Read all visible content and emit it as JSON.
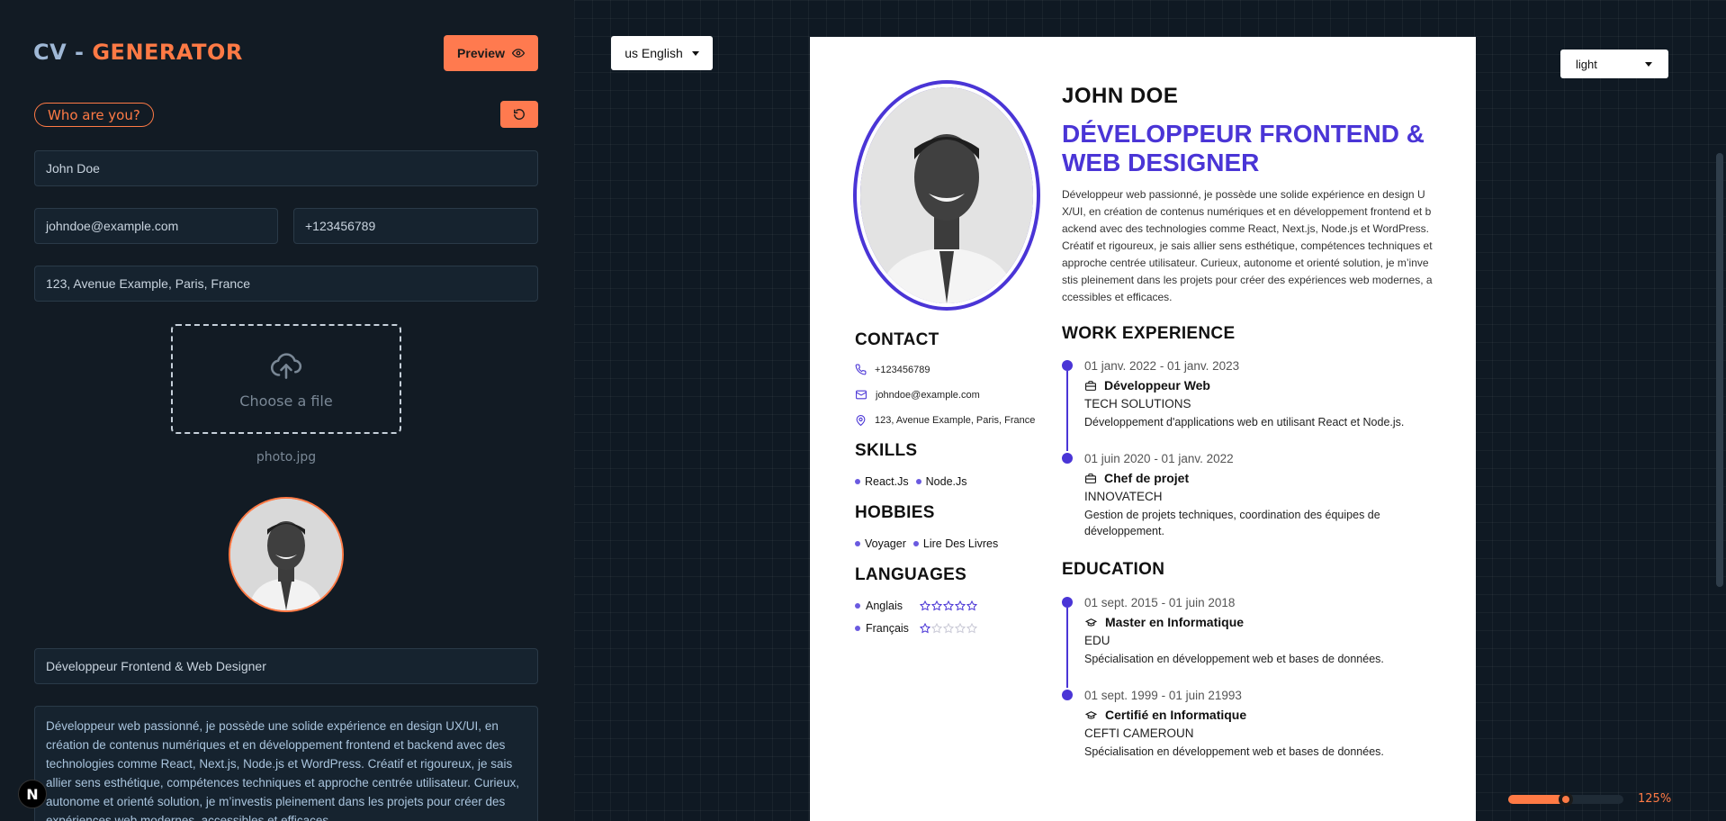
{
  "app": {
    "title_part1": "CV",
    "title_sep": " - ",
    "title_part2": "GENERATOR",
    "preview_label": "Preview"
  },
  "form": {
    "section_label": "Who are you?",
    "full_name": "John Doe",
    "email": "johndoe@example.com",
    "phone": "+123456789",
    "address": "123, Avenue Example, Paris, France",
    "upload_label": "Choose a file",
    "file_name": "photo.jpg",
    "job_title": "Développeur Frontend & Web Designer",
    "summary": "Développeur web passionné, je possède une solide expérience en design UX/UI, en création de contenus numériques et en développement frontend et backend avec des technologies comme React, Next.js, Node.js et WordPress. Créatif et rigoureux, je sais allier sens esthétique, compétences techniques et approche centrée utilisateur. Curieux, autonome et orienté solution, je m’investis pleinement dans les projets pour créer des expériences web modernes, accessibles et efficaces."
  },
  "nextjs_badge": "N",
  "toolbar": {
    "language": "us English",
    "theme": "light",
    "zoom_label": "125%",
    "zoom_fraction": 0.5
  },
  "cv": {
    "name": "JOHN DOE",
    "title": "DÉVELOPPEUR FRONTEND & WEB DESIGNER",
    "summary": "Développeur web passionné, je possède une solide expérience en design UX/UI, en création de contenus numériques et en développement frontend et backend avec des technologies comme React, Next.js, Node.js et WordPress. Créatif et rigoureux, je sais allier sens esthétique, compétences techniques et approche centrée utilisateur. Curieux, autonome et orienté solution, je m’investis pleinement dans les projets pour créer des expériences web modernes, accessibles et efficaces.",
    "contact_heading": "CONTACT",
    "phone": "+123456789",
    "email": "johndoe@example.com",
    "address": "123, Avenue Example, Paris, France",
    "skills_heading": "SKILLS",
    "skills": [
      "React.Js",
      "Node.Js"
    ],
    "hobbies_heading": "HOBBIES",
    "hobbies": [
      "Voyager",
      "Lire Des Livres"
    ],
    "languages_heading": "LANGUAGES",
    "languages": [
      {
        "name": "Anglais",
        "rating": 5
      },
      {
        "name": "Français",
        "rating": 1
      }
    ],
    "work_heading": "WORK EXPERIENCE",
    "work": [
      {
        "date": "01 janv. 2022 - 01 janv. 2023",
        "role": "Développeur Web",
        "company": "TECH SOLUTIONS",
        "desc": "Développement d'applications web en utilisant React et Node.js."
      },
      {
        "date": "01 juin 2020 - 01 janv. 2022",
        "role": "Chef de projet",
        "company": "INNOVATECH",
        "desc": "Gestion de projets techniques, coordination des équipes de développement."
      }
    ],
    "education_heading": "EDUCATION",
    "education": [
      {
        "date": "01 sept. 2015 - 01 juin 2018",
        "degree": "Master en Informatique",
        "school": "EDU",
        "desc": "Spécialisation en développement web et bases de données."
      },
      {
        "date": "01 sept. 1999 - 01 juin 21993",
        "degree": "Certifié en Informatique",
        "school": "CEFTI CAMEROUN",
        "desc": "Spécialisation en développement web et bases de données."
      }
    ]
  },
  "colors": {
    "accent": "#ff7a45",
    "cv_primary": "#4a35d6",
    "panel_bg": "#121b24"
  }
}
